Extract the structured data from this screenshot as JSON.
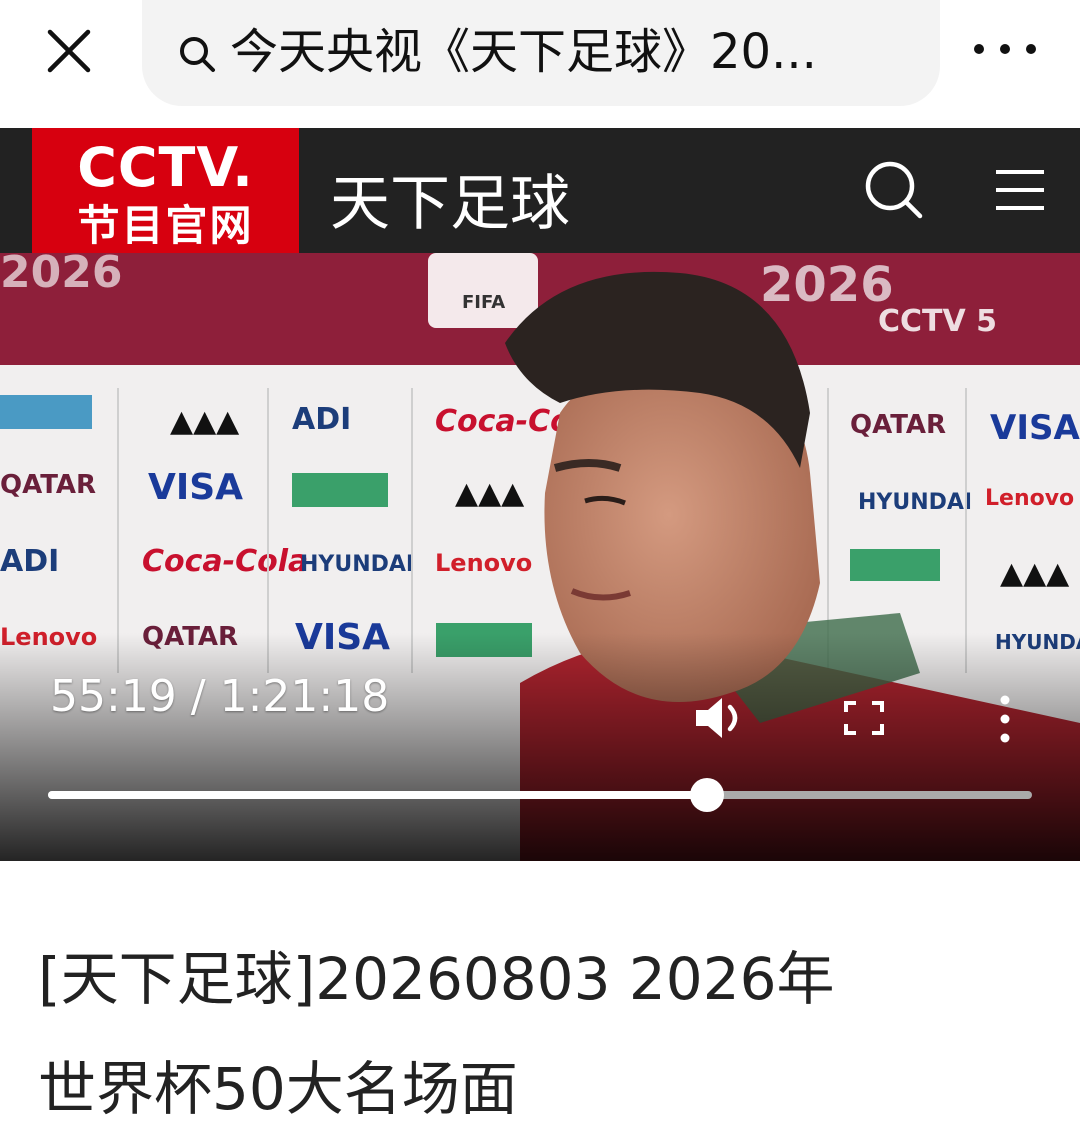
{
  "browser": {
    "search_text": "今天央视《天下足球》20...",
    "close_icon": "close-icon",
    "more_icon": "more-horizontal-icon"
  },
  "site_header": {
    "logo_top": "CCTV.",
    "logo_bottom": "节目官网",
    "title": "天下足球",
    "bg_color": "#222222",
    "logo_color": "#d7000f"
  },
  "video": {
    "time_display": "55:19 / 1:21:18",
    "progress_fraction": 0.67,
    "watermark_channel": "CCTV 5",
    "icons": [
      "volume-icon",
      "fullscreen-icon",
      "more-vertical-icon"
    ]
  },
  "article": {
    "title_line1": "[天下足球]20260803 2026年",
    "title_line2": "世界杯50大名场面"
  }
}
